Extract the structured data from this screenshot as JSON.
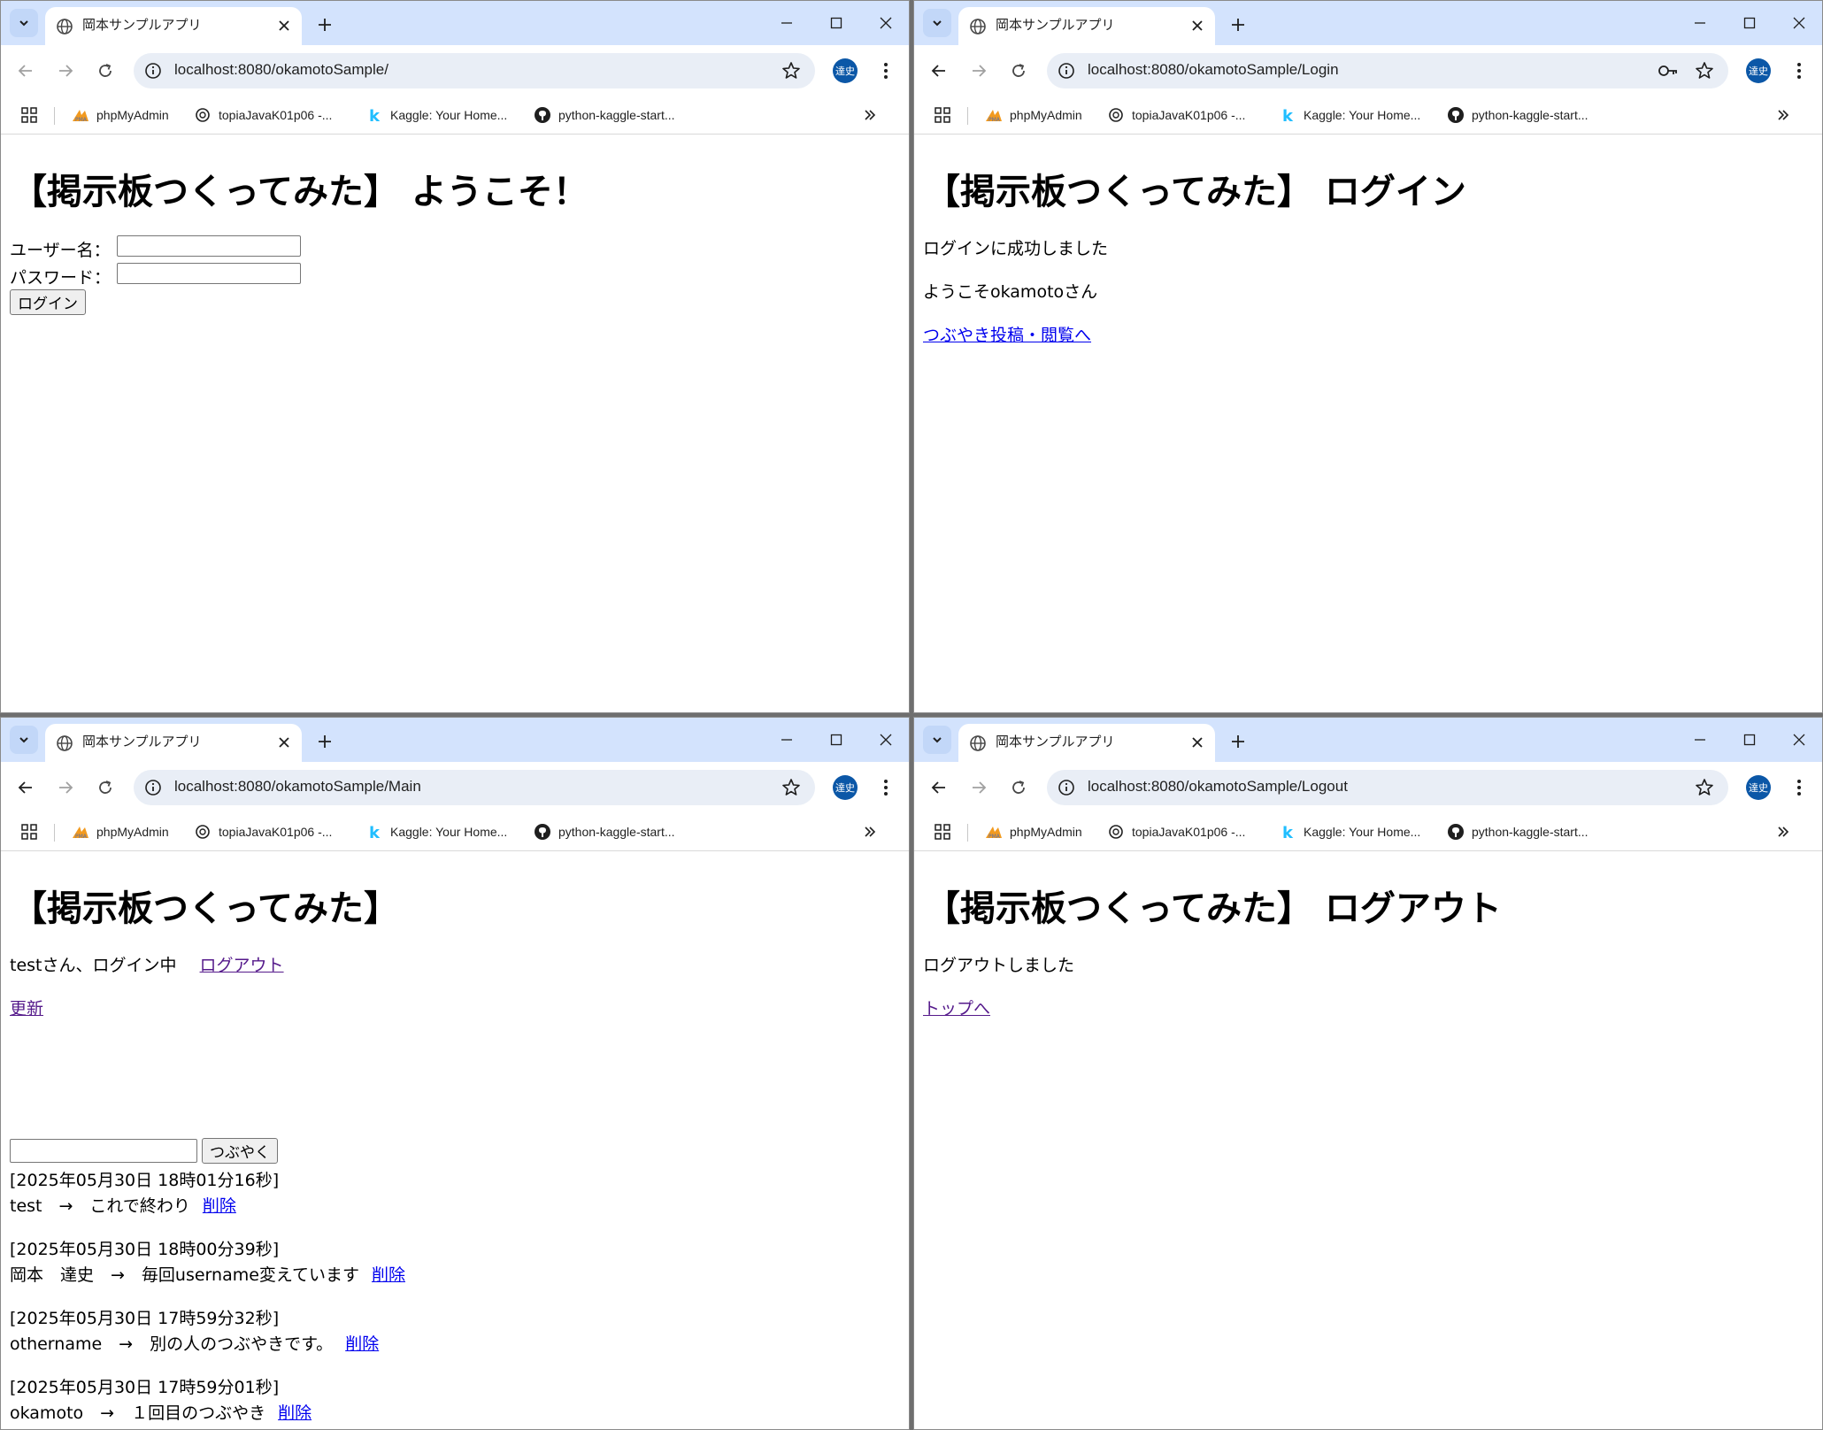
{
  "colors": {
    "tabstrip": "#d3e3fd",
    "omnibox": "#e9eef6",
    "link": "#0000ee",
    "visited_link": "#551a8b",
    "profile": "#0b57a7"
  },
  "bookmarks": [
    "phpMyAdmin",
    "topiaJavaK01p06 -...",
    "Kaggle: Your Home...",
    "python-kaggle-start..."
  ],
  "windows": [
    {
      "tab_title": "岡本サンプルアプリ",
      "url": "localhost:8080/okamotoSample/",
      "profile_initials": "達史",
      "page": {
        "heading": "【掲示板つくってみた】 ようこそ！",
        "username_label": "ユーザー名：",
        "username_value": "",
        "password_label": "パスワード：",
        "password_value": "",
        "login_button": "ログイン"
      }
    },
    {
      "tab_title": "岡本サンプルアプリ",
      "url": "localhost:8080/okamotoSample/Login",
      "profile_initials": "達史",
      "page": {
        "heading": "【掲示板つくってみた】 ログイン",
        "message": "ログインに成功しました",
        "welcome": "ようこそokamotoさん",
        "link": "つぶやき投稿・閲覧へ"
      }
    },
    {
      "tab_title": "岡本サンプルアプリ",
      "url": "localhost:8080/okamotoSample/Main",
      "profile_initials": "達史",
      "page": {
        "heading": "【掲示板つくってみた】",
        "login_status": "testさん、ログイン中",
        "logout_link": "ログアウト",
        "refresh_link": "更新",
        "post_input_value": "",
        "post_button": "つぶやく",
        "posts": [
          {
            "timestamp": "[2025年05月30日 18時01分16秒]",
            "text": "test　→　これで終わり",
            "delete": "削除"
          },
          {
            "timestamp": "[2025年05月30日 18時00分39秒]",
            "text": "岡本　達史　→　毎回username変えています",
            "delete": "削除"
          },
          {
            "timestamp": "[2025年05月30日 17時59分32秒]",
            "text": "othername　→　別の人のつぶやきです。",
            "delete": "削除"
          },
          {
            "timestamp": "[2025年05月30日 17時59分01秒]",
            "text": "okamoto　→　１回目のつぶやき",
            "delete": "削除"
          }
        ]
      }
    },
    {
      "tab_title": "岡本サンプルアプリ",
      "url": "localhost:8080/okamotoSample/Logout",
      "profile_initials": "達史",
      "page": {
        "heading": "【掲示板つくってみた】 ログアウト",
        "message": "ログアウトしました",
        "top_link": "トップへ"
      }
    }
  ]
}
